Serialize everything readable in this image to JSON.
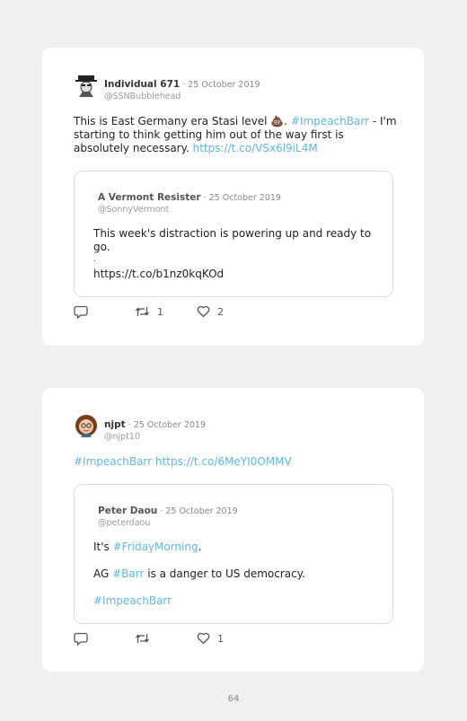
{
  "tweets": [
    {
      "author": "Individual 671",
      "date": "25 October 2019",
      "handle": "@SSNBubblehead",
      "text_before": "This is East Germany era Stasi level ",
      "emoji": "💩",
      "text_mid": ". ",
      "hashtag": "#ImpeachBarr",
      "text_after": " - I'm starting to think getting him out of the way first is absolutely necessary. ",
      "link": "https://t.co/VSx6l9iL4M",
      "quote": {
        "author": "A Vermont Resister",
        "date": "25 October 2019",
        "handle": "@SonnyVermont",
        "text": "This week's distraction is powering up and ready to go.",
        "dot": ".",
        "link": "https://t.co/b1nz0kqKOd"
      },
      "retweets": "1",
      "likes": "2"
    },
    {
      "author": "njpt",
      "date": "25 October 2019",
      "handle": "@njpt10",
      "hashtag": "#ImpeachBarr",
      "link": "https://t.co/6MeYI0OMMV",
      "quote": {
        "author": "Peter Daou",
        "date": "25 October 2019",
        "handle": "@peterdaou",
        "line1_pre": "It's ",
        "line1_tag": "#FridayMorning",
        "line1_post": ".",
        "line2_pre": "AG ",
        "line2_tag": "#Barr",
        "line2_post": " is a danger to US democracy.",
        "line3_tag": "#ImpeachBarr"
      },
      "retweets": "",
      "likes": "1"
    }
  ],
  "page_number": "64",
  "separator": " · ",
  "colors": {
    "link": "#5bb8e6",
    "background": "#f0f0f2",
    "card": "#ffffff"
  }
}
